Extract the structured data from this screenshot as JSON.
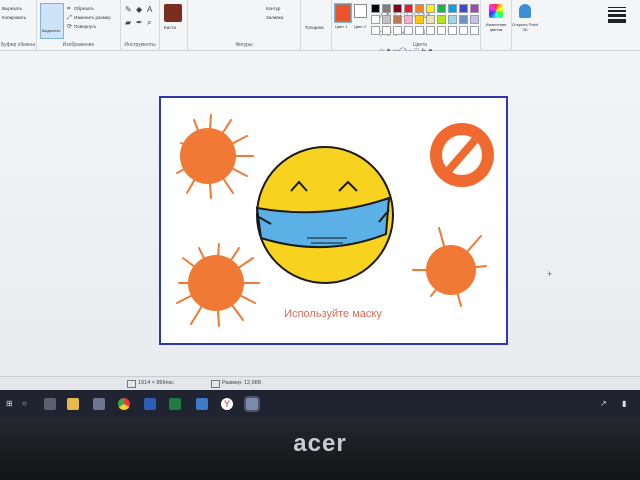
{
  "ribbon": {
    "clipboard": {
      "label": "Буфер обмена",
      "items": [
        "Вырезать",
        "Копировать"
      ]
    },
    "image": {
      "label": "Изображение",
      "select_label": "Выделить",
      "crop_label": "Обрезать",
      "resize_label": "Изменить размер",
      "rotate_label": "Повернуть"
    },
    "tools": {
      "label": "Инструменты",
      "brushes_label": "Кисти"
    },
    "shapes": {
      "label": "Фигуры",
      "outline_label": "Контур",
      "fill_label": "Заливка"
    },
    "size": {
      "label": "Толщина"
    },
    "colors": {
      "label": "Цвета",
      "color1_label": "Цвет 1",
      "color2_label": "Цвет 2",
      "edit_label": "Изменение цветов",
      "paint3d_label": "Открыть Paint 3D",
      "color1_value": "#e8552a",
      "color2_value": "#ffffff",
      "palette": [
        "#000000",
        "#7f7f7f",
        "#880015",
        "#ed1c24",
        "#ff7f27",
        "#fff200",
        "#22b14c",
        "#00a2e8",
        "#3f48cc",
        "#a349a4",
        "#ffffff",
        "#c3c3c3",
        "#b97a57",
        "#ffaec9",
        "#ffc90e",
        "#efe4b0",
        "#b5e61d",
        "#99d9ea",
        "#7092be",
        "#c8bfe7",
        "#ffffff",
        "#ffffff",
        "#ffffff",
        "#ffffff",
        "#ffffff",
        "#ffffff",
        "#ffffff",
        "#ffffff",
        "#ffffff",
        "#ffffff"
      ]
    }
  },
  "drawing": {
    "caption": "Используйте маску",
    "colors": {
      "sun": "#f07a35",
      "face": "#f7d21f",
      "mask": "#5bb0e6",
      "prohibit": "#f06a30",
      "frame": "#2f37b0"
    }
  },
  "status": {
    "dimensions": "1914 × 866пкс",
    "filesize": "Размер: 12,9КБ"
  },
  "taskbar": {
    "icons": [
      "start-icon",
      "search-icon",
      "task-view-icon",
      "file-explorer-icon",
      "store-icon",
      "chrome-icon",
      "word-icon",
      "excel-icon",
      "photos-icon",
      "yandex-icon",
      "paint-icon"
    ]
  },
  "bezel": {
    "brand": "acer"
  }
}
